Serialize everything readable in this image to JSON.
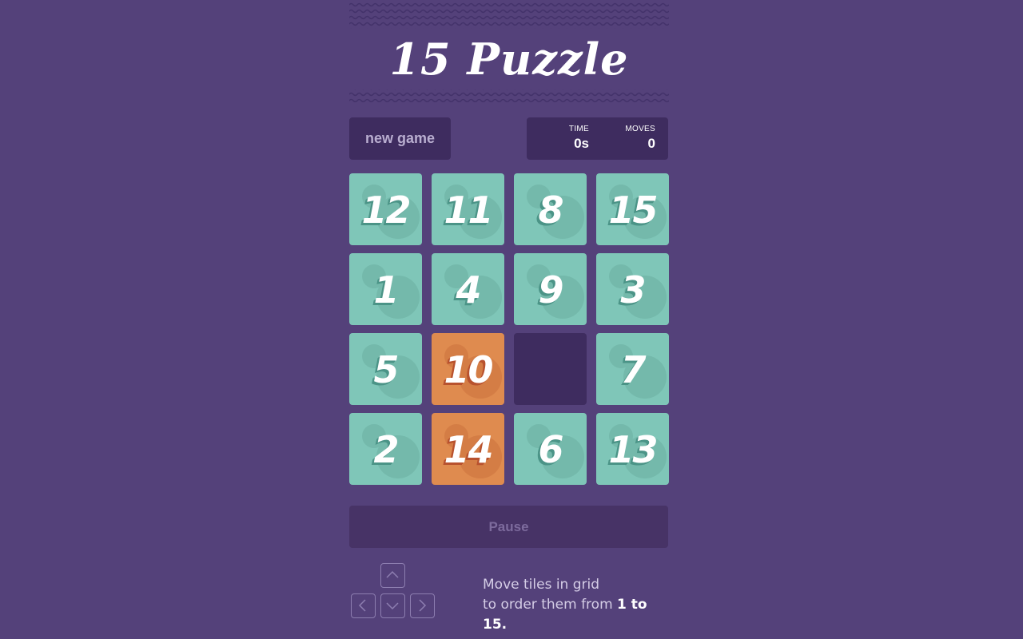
{
  "game": {
    "title": "15 Puzzle"
  },
  "controls": {
    "new_game_label": "new game",
    "pause_label": "Pause"
  },
  "stats": {
    "time_label": "TIME",
    "time_value": "0s",
    "moves_label": "MOVES",
    "moves_value": "0"
  },
  "board": {
    "tiles": [
      {
        "label": "12",
        "color": "teal"
      },
      {
        "label": "11",
        "color": "teal"
      },
      {
        "label": "8",
        "color": "teal"
      },
      {
        "label": "15",
        "color": "teal"
      },
      {
        "label": "1",
        "color": "teal"
      },
      {
        "label": "4",
        "color": "teal"
      },
      {
        "label": "9",
        "color": "teal"
      },
      {
        "label": "3",
        "color": "teal"
      },
      {
        "label": "5",
        "color": "teal"
      },
      {
        "label": "10",
        "color": "orange"
      },
      {
        "label": "",
        "color": "empty"
      },
      {
        "label": "7",
        "color": "teal"
      },
      {
        "label": "2",
        "color": "teal"
      },
      {
        "label": "14",
        "color": "orange"
      },
      {
        "label": "6",
        "color": "teal"
      },
      {
        "label": "13",
        "color": "teal"
      }
    ]
  },
  "instructions": {
    "line1": "Move tiles in grid",
    "line2_prefix": "to order them from ",
    "line2_emphasis": "1 to 15."
  },
  "icons": {
    "up": "chevron-up-icon",
    "left": "chevron-left-icon",
    "down": "chevron-down-icon",
    "right": "chevron-right-icon"
  },
  "colors": {
    "background": "#54417a",
    "panel": "#3e2c5f",
    "tile_teal": "#7fc6b8",
    "tile_orange": "#df8b4f",
    "empty_slot": "#3e2c5f"
  }
}
